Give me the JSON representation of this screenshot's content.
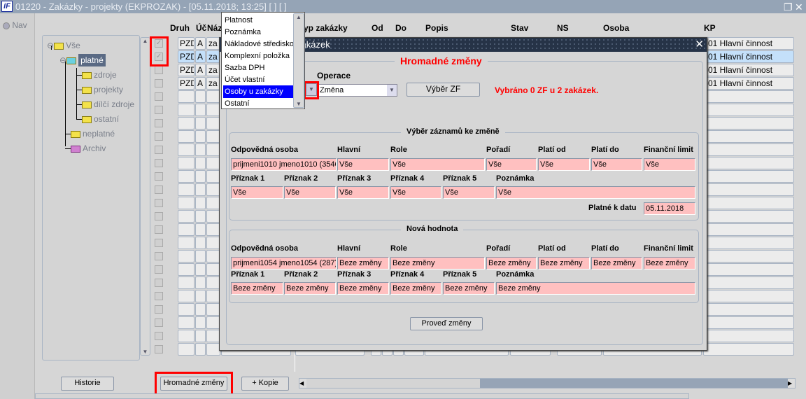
{
  "window": {
    "title": "01220 - Zakázky - projekty (EKPROZAK) - [05.11.2018; 13:25]  [ ]  [ ]",
    "logo": "iF",
    "restore_icon": "restore-icon",
    "close_icon": "close-icon"
  },
  "nav": {
    "label": "Nav"
  },
  "tree": {
    "root": "Vše",
    "platne": "platné",
    "children": [
      "zdroje",
      "projekty",
      "dílčí zdroje",
      "ostatní"
    ],
    "neplatne": "neplatné",
    "archiv": "Archiv"
  },
  "grid": {
    "headers": {
      "druh": "Druh",
      "uc": "Úč",
      "naz": "Náz",
      "typ": "yp zakázky",
      "od": "Od",
      "do": "Do",
      "popis": "Popis",
      "stav": "Stav",
      "ns": "NS",
      "osoba": "Osoba",
      "kp": "KP"
    },
    "rows": [
      {
        "checked": true,
        "druh": "PZD",
        "uc": "A",
        "naz": "za",
        "kp": "-01 Hlavní činnost",
        "selected": false
      },
      {
        "checked": true,
        "druh": "PZD",
        "uc": "A",
        "naz": "za",
        "kp": "-01 Hlavní činnost",
        "selected": true
      },
      {
        "checked": false,
        "druh": "PZD",
        "uc": "A",
        "naz": "za",
        "kp": "-01 Hlavní činnost",
        "selected": false
      },
      {
        "checked": false,
        "druh": "PZD",
        "uc": "A",
        "naz": "za",
        "kp": "-01 Hlavní činnost",
        "selected": false
      }
    ]
  },
  "dropdown": {
    "items": [
      "Platnost",
      "Poznámka",
      "Nákladové středisko",
      "Komplexní položka",
      "Sazba DPH",
      "Účet vlastní",
      "Osoby u zakázky",
      "Ostatní"
    ],
    "selected": "Osoby u zakázky"
  },
  "dialog": {
    "title": "zakázek",
    "group_title": "Hromadné změny",
    "operace_label": "Operace",
    "operace_value": "Změna",
    "vyber_zf": "Výběr ZF",
    "status": "Vybráno 0 ZF u 2 zakázek.",
    "selection": {
      "title": "Výběr záznamů ke změně",
      "labels1": [
        "Odpovědná osoba",
        "Hlavní",
        "Role",
        "Pořadí",
        "Platí od",
        "Platí do",
        "Finanční limit"
      ],
      "values1": [
        "prijmeni1010 jmeno1010 (3546",
        "Vše",
        "Vše",
        "Vše",
        "Vše",
        "Vše",
        "Vše"
      ],
      "labels2": [
        "Příznak 1",
        "Příznak 2",
        "Příznak 3",
        "Příznak 4",
        "Příznak 5",
        "Poznámka"
      ],
      "values2": [
        "Vše",
        "Vše",
        "Vše",
        "Vše",
        "Vše",
        "Vše"
      ],
      "date_label": "Platné k datu",
      "date_value": "05.11.2018"
    },
    "newvalue": {
      "title": "Nová hodnota",
      "labels1": [
        "Odpovědná osoba",
        "Hlavní",
        "Role",
        "Pořadí",
        "Platí od",
        "Platí do",
        "Finanční limit"
      ],
      "values1": [
        "prijmeni1054 jmeno1054 (287)",
        "Beze změny",
        "Beze změny",
        "Beze změny",
        "Beze změny",
        "Beze změny",
        "Beze změny"
      ],
      "labels2": [
        "Příznak 1",
        "Příznak 2",
        "Příznak 3",
        "Příznak 4",
        "Příznak 5",
        "Poznámka"
      ],
      "values2": [
        "Beze změny",
        "Beze změny",
        "Beze změny",
        "Beze změny",
        "Beze změny",
        "Beze změny"
      ]
    },
    "submit": "Proveď změny"
  },
  "bottom": {
    "historie": "Historie",
    "hromadne": "Hromadné změny",
    "kopie": "+ Kopie",
    "scroll_fraction": 0.36
  },
  "colors": {
    "titlebar": "#95a4b6",
    "dialog_title": "#263347",
    "highlight": "#0000ff",
    "error": "#ff0000",
    "field": "#ffc0c0",
    "selected_row": "#c4e0fa"
  }
}
